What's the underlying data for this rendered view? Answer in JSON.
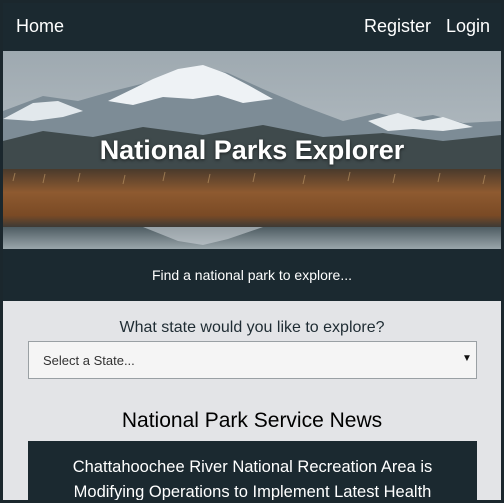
{
  "nav": {
    "home_label": "Home",
    "register_label": "Register",
    "login_label": "Login"
  },
  "hero": {
    "title": "National Parks Explorer"
  },
  "findbar": {
    "text": "Find a national park to explore..."
  },
  "state_picker": {
    "question": "What state would you like to explore?",
    "selected": "Select a State..."
  },
  "news": {
    "heading": "National Park Service News",
    "items": [
      {
        "title": "Chattahoochee River National Recreation Area is Modifying Operations to Implement Latest Health"
      }
    ]
  },
  "colors": {
    "nav_bg": "#1b2930",
    "page_bg": "#e3e4e7",
    "text_light": "#ffffff"
  }
}
